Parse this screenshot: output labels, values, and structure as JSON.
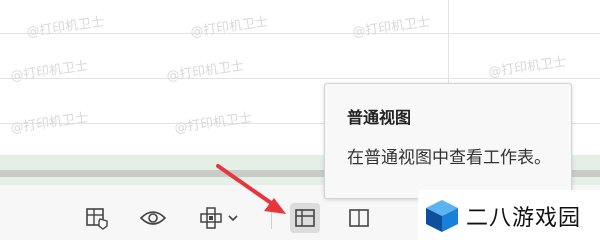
{
  "watermark": "@打印机卫士",
  "status_bar": {
    "icons": [
      "page-break-preview-icon",
      "reading-view-icon",
      "focus-mode-icon",
      "chevron-down-icon",
      "normal-view-icon",
      "page-layout-icon"
    ],
    "active": "normal-view-icon"
  },
  "tooltip": {
    "title": "普通视图",
    "body": "在普通视图中查看工作表。"
  },
  "branding": {
    "text": "二八游戏园"
  },
  "colors": {
    "accent": "#e8343a",
    "band": "#e4efe6",
    "logo_blue": "#1a7fd6"
  }
}
